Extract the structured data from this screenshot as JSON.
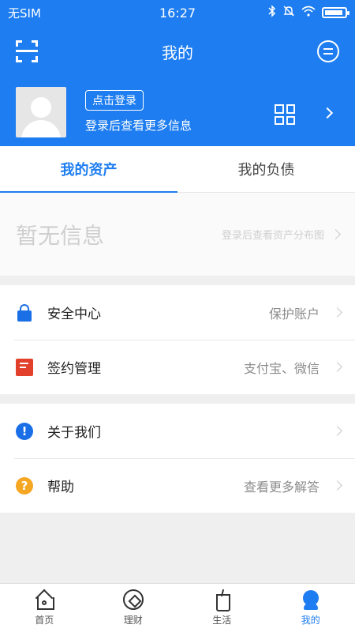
{
  "status_bar": {
    "carrier": "无SIM",
    "time": "16:27",
    "icons": [
      "bluetooth-icon",
      "mute-icon",
      "wifi-icon",
      "battery-icon"
    ],
    "battery_level": 0.9
  },
  "header": {
    "title": "我的",
    "left_icon": "scan-icon",
    "right_icon": "message-icon"
  },
  "profile": {
    "login_button": "点击登录",
    "login_hint": "登录后查看更多信息",
    "qr_icon": "qr-code-icon"
  },
  "tabs": [
    {
      "label": "我的资产",
      "active": true
    },
    {
      "label": "我的负债",
      "active": false
    }
  ],
  "asset_panel": {
    "empty_title": "暂无信息",
    "hint": "登录后查看资产分布图"
  },
  "menu_group_1": [
    {
      "icon": "lock-icon",
      "label": "安全中心",
      "value": "保护账户"
    },
    {
      "icon": "contract-icon",
      "label": "签约管理",
      "value": "支付宝、微信"
    }
  ],
  "menu_group_2": [
    {
      "icon": "info-icon",
      "label": "关于我们",
      "value": ""
    },
    {
      "icon": "help-icon",
      "label": "帮助",
      "value": "查看更多解答"
    }
  ],
  "icon_glyphs": {
    "info": "!",
    "help": "?"
  },
  "bottom_nav": [
    {
      "icon": "home-icon",
      "label": "首页",
      "active": false
    },
    {
      "icon": "finance-icon",
      "label": "理财",
      "active": false
    },
    {
      "icon": "life-icon",
      "label": "生活",
      "active": false
    },
    {
      "icon": "me-icon",
      "label": "我的",
      "active": true
    }
  ],
  "colors": {
    "primary": "#1e7df0",
    "lock": "#1a6fe6",
    "contract": "#e2402b",
    "help": "#f5a623"
  }
}
